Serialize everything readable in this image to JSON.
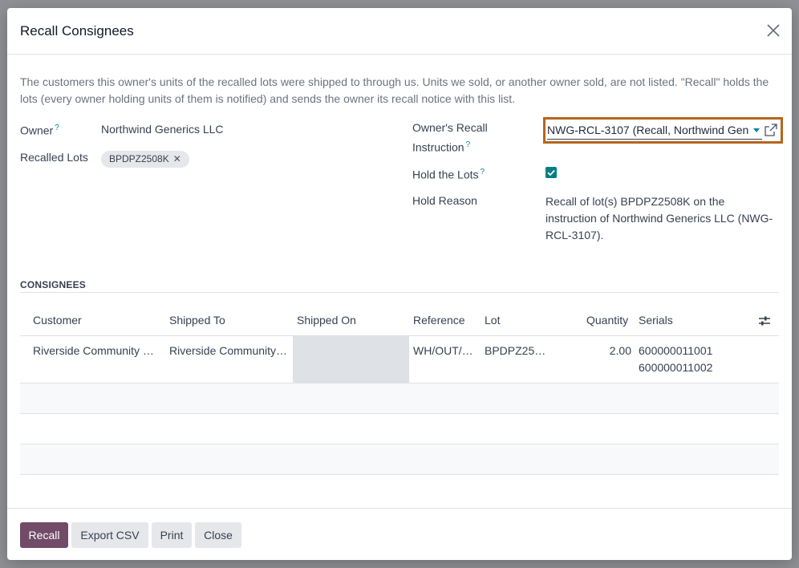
{
  "dialog": {
    "title": "Recall Consignees",
    "description": "The customers this owner's units of the recalled lots were shipped to through us. Units we sold, or another owner sold, are not listed. \"Recall\" holds the lots (every owner holding units of them is notified) and sends the owner its recall notice with this list."
  },
  "form": {
    "owner_label": "Owner",
    "owner_value": "Northwind Generics LLC",
    "lots_label": "Recalled Lots",
    "lot_tag": "BPDPZ2508K",
    "instruction_label_line1": "Owner's Recall",
    "instruction_label_line2": "Instruction",
    "instruction_value": "NWG-RCL-3107 (Recall, Northwind Gen",
    "hold_label": "Hold the Lots",
    "hold_checked": true,
    "reason_label": "Hold Reason",
    "reason_line1": "Recall of lot(s) BPDPZ2508K on the",
    "reason_line2": "instruction of Northwind Generics LLC (NWG-",
    "reason_line3": "RCL-3107).",
    "help_mark": "?"
  },
  "consignees": {
    "section_title": "CONSIGNEES",
    "columns": [
      "Customer",
      "Shipped To",
      "Shipped On",
      "Reference",
      "Lot",
      "Quantity",
      "Serials"
    ],
    "rows": [
      {
        "customer": "Riverside Community …",
        "shipped_to": "Riverside Community…",
        "shipped_on": "",
        "reference": "WH/OUT/…",
        "lot": "BPDPZ25…",
        "quantity": "2.00",
        "serial_1": "600000011001",
        "serial_2": "600000011002"
      }
    ]
  },
  "footer": {
    "recall": "Recall",
    "export_csv": "Export CSV",
    "print": "Print",
    "close": "Close"
  },
  "colors": {
    "primary": "#714b67",
    "focus_outline": "#b5651d",
    "checkbox": "#017e84",
    "help": "#0a7ea4"
  },
  "icons": [
    "close-icon",
    "dropdown-caret-icon",
    "external-link-icon",
    "checkmark-icon",
    "column-settings-icon",
    "remove-tag-icon"
  ]
}
